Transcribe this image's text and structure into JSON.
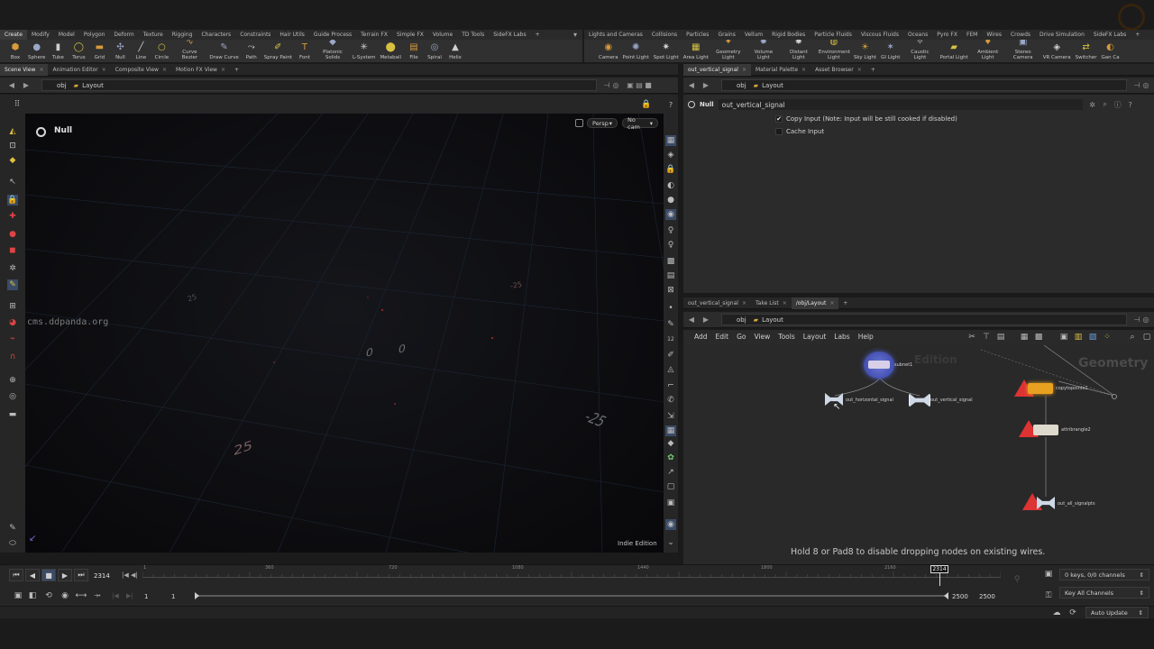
{
  "watermark": "cms.ddpanda.org",
  "left_shelf": {
    "tabs": [
      "Create",
      "Modify",
      "Model",
      "Polygon",
      "Deform",
      "Texture",
      "Rigging",
      "Characters",
      "Constraints",
      "Hair Utils",
      "Guide Process",
      "Terrain FX",
      "Simple FX",
      "Volume",
      "TD Tools",
      "SideFX Labs"
    ],
    "tools": [
      {
        "label": "Box",
        "icon": "box-icon",
        "glyph": "⬢"
      },
      {
        "label": "Sphere",
        "icon": "sphere-icon",
        "glyph": "●"
      },
      {
        "label": "Tube",
        "icon": "tube-icon",
        "glyph": "▮"
      },
      {
        "label": "Torus",
        "icon": "torus-icon",
        "glyph": "◯"
      },
      {
        "label": "Grid",
        "icon": "grid-icon",
        "glyph": "▬"
      },
      {
        "label": "Null",
        "icon": "null-icon",
        "glyph": "✣"
      },
      {
        "label": "Line",
        "icon": "line-icon",
        "glyph": "╱"
      },
      {
        "label": "Circle",
        "icon": "circle-icon",
        "glyph": "○"
      },
      {
        "label": "Curve Bezier",
        "icon": "curve-bezier-icon",
        "glyph": "∿"
      },
      {
        "label": "Draw Curve",
        "icon": "draw-curve-icon",
        "glyph": "✎"
      },
      {
        "label": "Path",
        "icon": "path-icon",
        "glyph": "⤳"
      },
      {
        "label": "Spray Paint",
        "icon": "spray-paint-icon",
        "glyph": "✐"
      },
      {
        "label": "Font",
        "icon": "font-icon",
        "glyph": "T"
      },
      {
        "label": "Platonic Solids",
        "icon": "platonic-solids-icon",
        "glyph": "◆"
      },
      {
        "label": "L-System",
        "icon": "l-system-icon",
        "glyph": "✳"
      },
      {
        "label": "Metaball",
        "icon": "metaball-icon",
        "glyph": "⬤"
      },
      {
        "label": "File",
        "icon": "file-icon",
        "glyph": "▤"
      },
      {
        "label": "Spiral",
        "icon": "spiral-icon",
        "glyph": "◎"
      },
      {
        "label": "Helix",
        "icon": "helix-icon",
        "glyph": "▲"
      }
    ]
  },
  "right_shelf": {
    "tabs": [
      "Lights and Cameras",
      "Collisions",
      "Particles",
      "Grains",
      "Vellum",
      "Rigid Bodies",
      "Particle Fluids",
      "Viscous Fluids",
      "Oceans",
      "Pyro FX",
      "FEM",
      "Wires",
      "Crowds",
      "Drive Simulation",
      "SideFX Labs"
    ],
    "tools": [
      {
        "label": "Camera",
        "icon": "camera-icon",
        "glyph": "◉"
      },
      {
        "label": "Point Light",
        "icon": "point-light-icon",
        "glyph": "✺"
      },
      {
        "label": "Spot Light",
        "icon": "spot-light-icon",
        "glyph": "✷"
      },
      {
        "label": "Area Light",
        "icon": "area-light-icon",
        "glyph": "▦"
      },
      {
        "label": "Geometry Light",
        "icon": "geometry-light-icon",
        "glyph": "✦"
      },
      {
        "label": "Volume Light",
        "icon": "volume-light-icon",
        "glyph": "✹"
      },
      {
        "label": "Distant Light",
        "icon": "distant-light-icon",
        "glyph": "✸"
      },
      {
        "label": "Environment Light",
        "icon": "environment-light-icon",
        "glyph": "◍"
      },
      {
        "label": "Sky Light",
        "icon": "sky-light-icon",
        "glyph": "☀"
      },
      {
        "label": "GI Light",
        "icon": "gi-light-icon",
        "glyph": "✶"
      },
      {
        "label": "Caustic Light",
        "icon": "caustic-light-icon",
        "glyph": "✧"
      },
      {
        "label": "Portal Light",
        "icon": "portal-light-icon",
        "glyph": "▰"
      },
      {
        "label": "Ambient Light",
        "icon": "ambient-light-icon",
        "glyph": "♦"
      },
      {
        "label": "Stereo Camera",
        "icon": "stereo-camera-icon",
        "glyph": "▣"
      },
      {
        "label": "VR Camera",
        "icon": "vr-camera-icon",
        "glyph": "◈"
      },
      {
        "label": "Switcher",
        "icon": "switcher-icon",
        "glyph": "⇄"
      },
      {
        "label": "Gan Ca",
        "icon": "gan-camera-icon",
        "glyph": "◐"
      }
    ]
  },
  "left_pane": {
    "tabs": [
      "Scene View",
      "Animation Editor",
      "Composite View",
      "Motion FX View"
    ],
    "path_root": "obj",
    "path_node": "Layout",
    "node_name": "Null",
    "persp_label": "Persp",
    "cam_label": "No cam",
    "edition_label": "Indie Edition",
    "grid_labels": [
      "0",
      "0",
      "25",
      "-25",
      "-25",
      "25"
    ]
  },
  "params_pane": {
    "tabs": [
      "out_vertical_signal",
      "Material Palette",
      "Asset Browser"
    ],
    "path_root": "obj",
    "path_node": "Layout",
    "node_type": "Null",
    "node_name": "out_vertical_signal",
    "params": [
      {
        "label": "Copy Input (Note: Input will be still cooked if disabled)",
        "checked": true
      },
      {
        "label": "Cache Input",
        "checked": false
      }
    ]
  },
  "network_pane": {
    "tabs": [
      "out_vertical_signal",
      "Take List",
      "/obj/Layout"
    ],
    "path_root": "obj",
    "path_node": "Layout",
    "menu": [
      "Add",
      "Edit",
      "Go",
      "View",
      "Tools",
      "Layout",
      "Labs",
      "Help"
    ],
    "watermark_edition": "Edition",
    "context_label": "Geometry",
    "hint": "Hold 8 or Pad8 to disable dropping nodes on existing wires.",
    "nodes": [
      {
        "name": "subnet1"
      },
      {
        "name": "out_horizontal_signal"
      },
      {
        "name": "out_vertical_signal"
      },
      {
        "name": "copytopoints1"
      },
      {
        "name": "attribrangle2"
      },
      {
        "name": "out_all_signalpts"
      }
    ]
  },
  "timeline": {
    "current_frame": "2314",
    "ticks": [
      "1",
      "360",
      "720",
      "1080",
      "1440",
      "1800",
      "2160"
    ],
    "playhead_label": "2314",
    "start_a": "1",
    "start_b": "1",
    "end_a": "2500",
    "end_b": "2500",
    "keys_status": "0 keys, 0/0 channels",
    "channels_button": "Key All Channels",
    "auto_update": "Auto Update"
  }
}
